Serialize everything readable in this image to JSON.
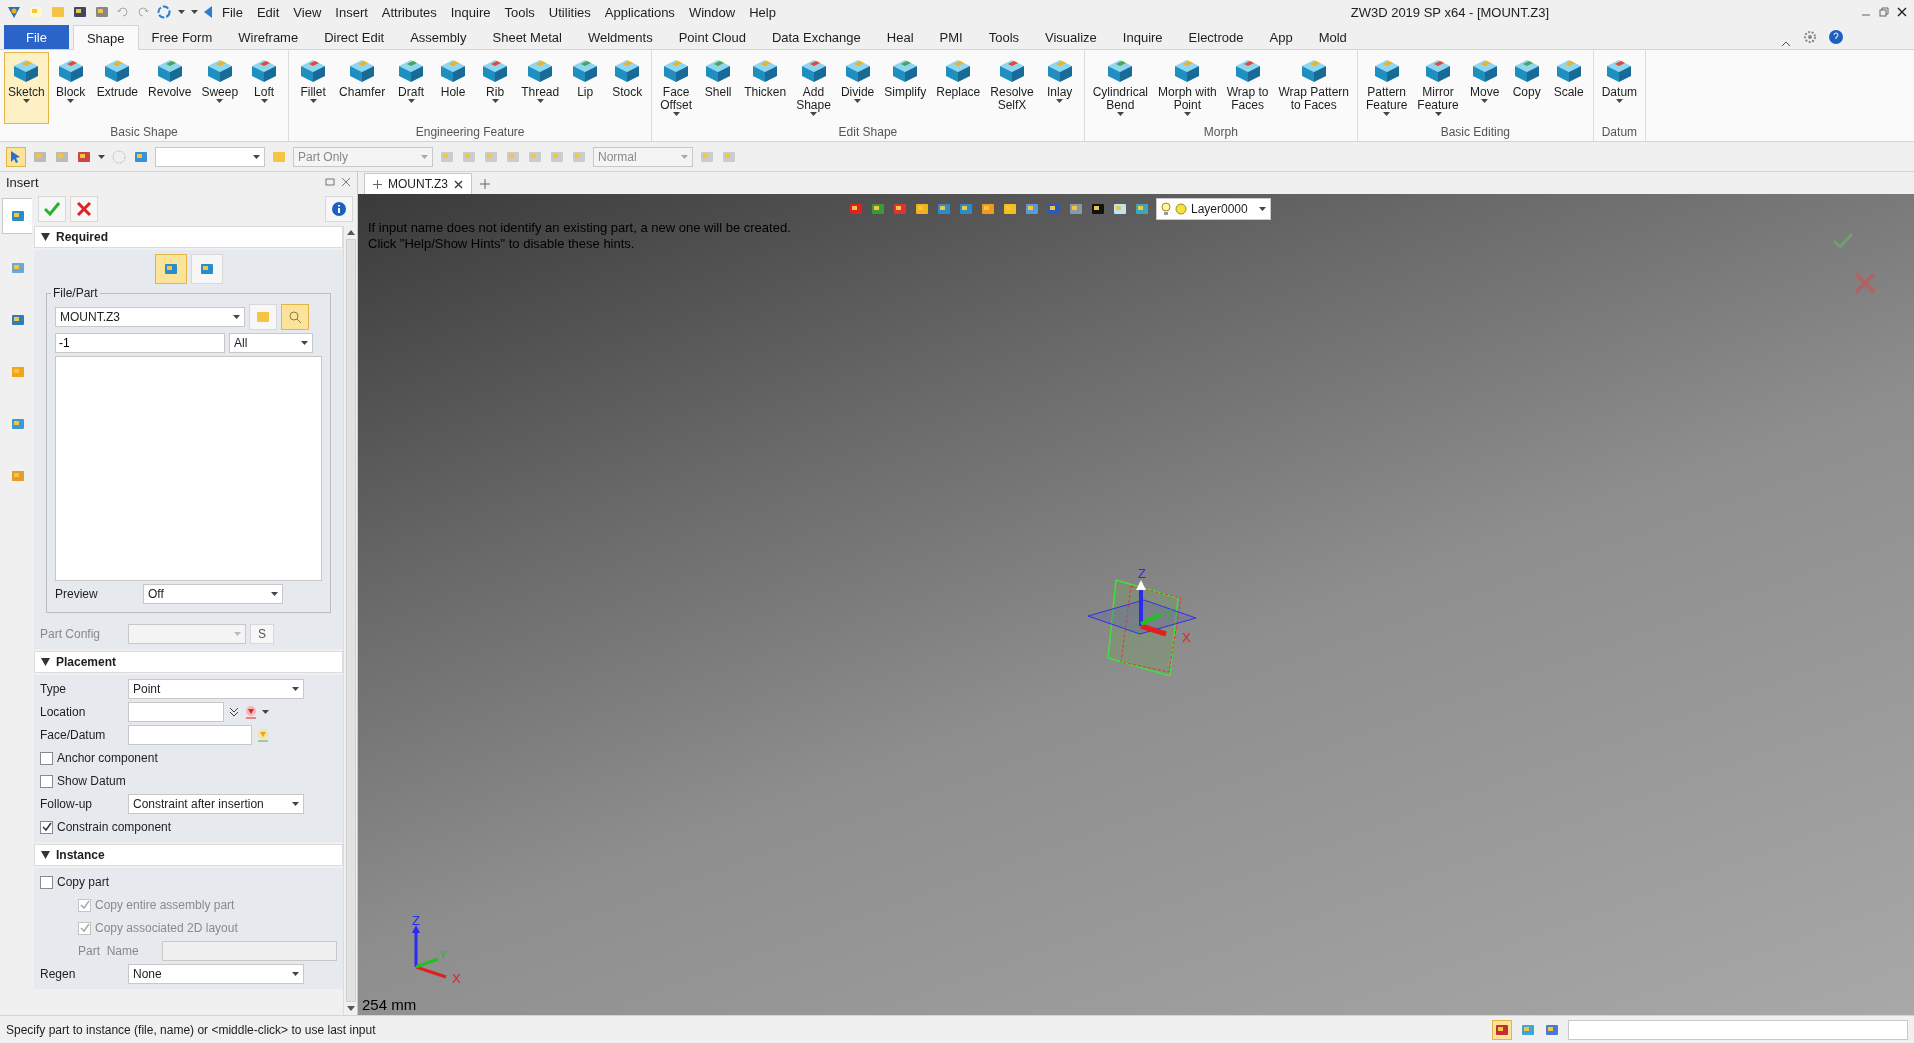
{
  "title_bar": {
    "title": "ZW3D 2019 SP x64 - [MOUNT.Z3]",
    "menu": [
      "File",
      "Edit",
      "View",
      "Insert",
      "Attributes",
      "Inquire",
      "Tools",
      "Utilities",
      "Applications",
      "Window",
      "Help"
    ]
  },
  "ribbon_tabs": [
    {
      "label": "File",
      "kind": "app",
      "selected": false
    },
    {
      "label": "Shape",
      "kind": "tab",
      "selected": true
    },
    {
      "label": "Free Form",
      "kind": "tab",
      "selected": false
    },
    {
      "label": "Wireframe",
      "kind": "tab",
      "selected": false
    },
    {
      "label": "Direct Edit",
      "kind": "tab",
      "selected": false
    },
    {
      "label": "Assembly",
      "kind": "tab",
      "selected": false
    },
    {
      "label": "Sheet Metal",
      "kind": "tab",
      "selected": false
    },
    {
      "label": "Weldments",
      "kind": "tab",
      "selected": false
    },
    {
      "label": "Point Cloud",
      "kind": "tab",
      "selected": false
    },
    {
      "label": "Data Exchange",
      "kind": "tab",
      "selected": false
    },
    {
      "label": "Heal",
      "kind": "tab",
      "selected": false
    },
    {
      "label": "PMI",
      "kind": "tab",
      "selected": false
    },
    {
      "label": "Tools",
      "kind": "tab",
      "selected": false
    },
    {
      "label": "Visualize",
      "kind": "tab",
      "selected": false
    },
    {
      "label": "Inquire",
      "kind": "tab",
      "selected": false
    },
    {
      "label": "Electrode",
      "kind": "tab",
      "selected": false
    },
    {
      "label": "App",
      "kind": "tab",
      "selected": false
    },
    {
      "label": "Mold",
      "kind": "tab",
      "selected": false
    }
  ],
  "ribbon_groups": [
    {
      "label": "Basic Shape",
      "buttons": [
        {
          "label": "Sketch",
          "dropdown": true,
          "selected": true
        },
        {
          "label": "Block",
          "dropdown": true,
          "selected": false
        },
        {
          "label": "Extrude",
          "dropdown": false,
          "selected": false
        },
        {
          "label": "Revolve",
          "dropdown": false,
          "selected": false
        },
        {
          "label": "Sweep",
          "dropdown": true,
          "selected": false
        },
        {
          "label": "Loft",
          "dropdown": true,
          "selected": false
        }
      ]
    },
    {
      "label": "Engineering Feature",
      "buttons": [
        {
          "label": "Fillet",
          "dropdown": true,
          "selected": false
        },
        {
          "label": "Chamfer",
          "dropdown": false,
          "selected": false
        },
        {
          "label": "Draft",
          "dropdown": true,
          "selected": false
        },
        {
          "label": "Hole",
          "dropdown": false,
          "selected": false
        },
        {
          "label": "Rib",
          "dropdown": true,
          "selected": false
        },
        {
          "label": "Thread",
          "dropdown": true,
          "selected": false
        },
        {
          "label": "Lip",
          "dropdown": false,
          "selected": false
        },
        {
          "label": "Stock",
          "dropdown": false,
          "selected": false
        }
      ]
    },
    {
      "label": "Edit Shape",
      "buttons": [
        {
          "label": "Face\nOffset",
          "dropdown": true,
          "selected": false
        },
        {
          "label": "Shell",
          "dropdown": false,
          "selected": false
        },
        {
          "label": "Thicken",
          "dropdown": false,
          "selected": false
        },
        {
          "label": "Add\nShape",
          "dropdown": true,
          "selected": false
        },
        {
          "label": "Divide",
          "dropdown": true,
          "selected": false
        },
        {
          "label": "Simplify",
          "dropdown": false,
          "selected": false
        },
        {
          "label": "Replace",
          "dropdown": false,
          "selected": false
        },
        {
          "label": "Resolve\nSelfX",
          "dropdown": false,
          "selected": false
        },
        {
          "label": "Inlay",
          "dropdown": true,
          "selected": false
        }
      ]
    },
    {
      "label": "Morph",
      "buttons": [
        {
          "label": "Cylindrical\nBend",
          "dropdown": true,
          "selected": false
        },
        {
          "label": "Morph with\nPoint",
          "dropdown": true,
          "selected": false
        },
        {
          "label": "Wrap to\nFaces",
          "dropdown": false,
          "selected": false
        },
        {
          "label": "Wrap Pattern\nto Faces",
          "dropdown": false,
          "selected": false
        }
      ]
    },
    {
      "label": "Basic Editing",
      "buttons": [
        {
          "label": "Pattern\nFeature",
          "dropdown": true,
          "selected": false
        },
        {
          "label": "Mirror\nFeature",
          "dropdown": true,
          "selected": false
        },
        {
          "label": "Move",
          "dropdown": true,
          "selected": false
        },
        {
          "label": "Copy",
          "dropdown": false,
          "selected": false
        },
        {
          "label": "Scale",
          "dropdown": false,
          "selected": false
        }
      ]
    },
    {
      "label": "Datum",
      "buttons": [
        {
          "label": "Datum",
          "dropdown": true,
          "selected": false
        }
      ]
    }
  ],
  "toolbar": {
    "select_filter_active": true,
    "scope": "Part Only",
    "render_mode": "Normal"
  },
  "panel": {
    "title": "Insert",
    "side_tabs": [
      {
        "selected": true
      },
      {
        "selected": false
      },
      {
        "selected": false
      },
      {
        "selected": false
      },
      {
        "selected": false
      },
      {
        "selected": false
      }
    ],
    "required": {
      "title": "Required",
      "expanded": true,
      "modes": [
        {
          "selected": true
        },
        {
          "selected": false
        }
      ],
      "group_title": "File/Part",
      "file": "MOUNT.Z3",
      "search_selected": true,
      "name": "-1",
      "filter": "All",
      "preview_label": "Preview",
      "preview": "Off",
      "part_config_label": "Part Config",
      "part_config_disabled": true,
      "config_button": "S"
    },
    "placement": {
      "title": "Placement",
      "expanded": true,
      "rows": [
        {
          "kind": "select",
          "label": "Type",
          "value": "Point"
        },
        {
          "kind": "location",
          "label": "Location"
        },
        {
          "kind": "pick",
          "label": "Face/Datum"
        },
        {
          "kind": "checkbox",
          "label": "Anchor component",
          "checked": false,
          "disabled": false
        },
        {
          "kind": "checkbox",
          "label": "Show Datum",
          "checked": false,
          "disabled": false
        },
        {
          "kind": "select",
          "label": "Follow-up",
          "value": "Constraint after insertion"
        },
        {
          "kind": "checkbox",
          "label": "Constrain component",
          "checked": true,
          "disabled": false
        }
      ]
    },
    "instance": {
      "title": "Instance",
      "expanded": true,
      "rows": [
        {
          "kind": "checkbox",
          "label": "Copy part",
          "checked": false,
          "disabled": false,
          "children": [
            {
              "kind": "checkbox",
              "label": "Copy entire assembly part",
              "checked": true,
              "disabled": true
            },
            {
              "kind": "checkbox",
              "label": "Copy associated 2D layout",
              "checked": true,
              "disabled": true
            },
            {
              "kind": "input",
              "label": "Part  Name",
              "disabled": true
            }
          ]
        },
        {
          "kind": "select",
          "label": "Regen",
          "value": "None"
        }
      ]
    }
  },
  "doc_tabs": [
    {
      "label": "MOUNT.Z3",
      "selected": true
    }
  ],
  "viewport": {
    "hints": [
      "If input name does not identify an existing part, a new one will be created.",
      "Click \"Help/Show Hints\" to disable these hints."
    ],
    "layer": "Layer0000",
    "model_triad": [
      "Z",
      "Y",
      "X"
    ],
    "view_triad": [
      "Z",
      "Y",
      "X"
    ],
    "scale": "254 mm"
  },
  "status_bar": {
    "prompt": "Specify part to instance (file, name) or <middle-click> to use last input"
  }
}
